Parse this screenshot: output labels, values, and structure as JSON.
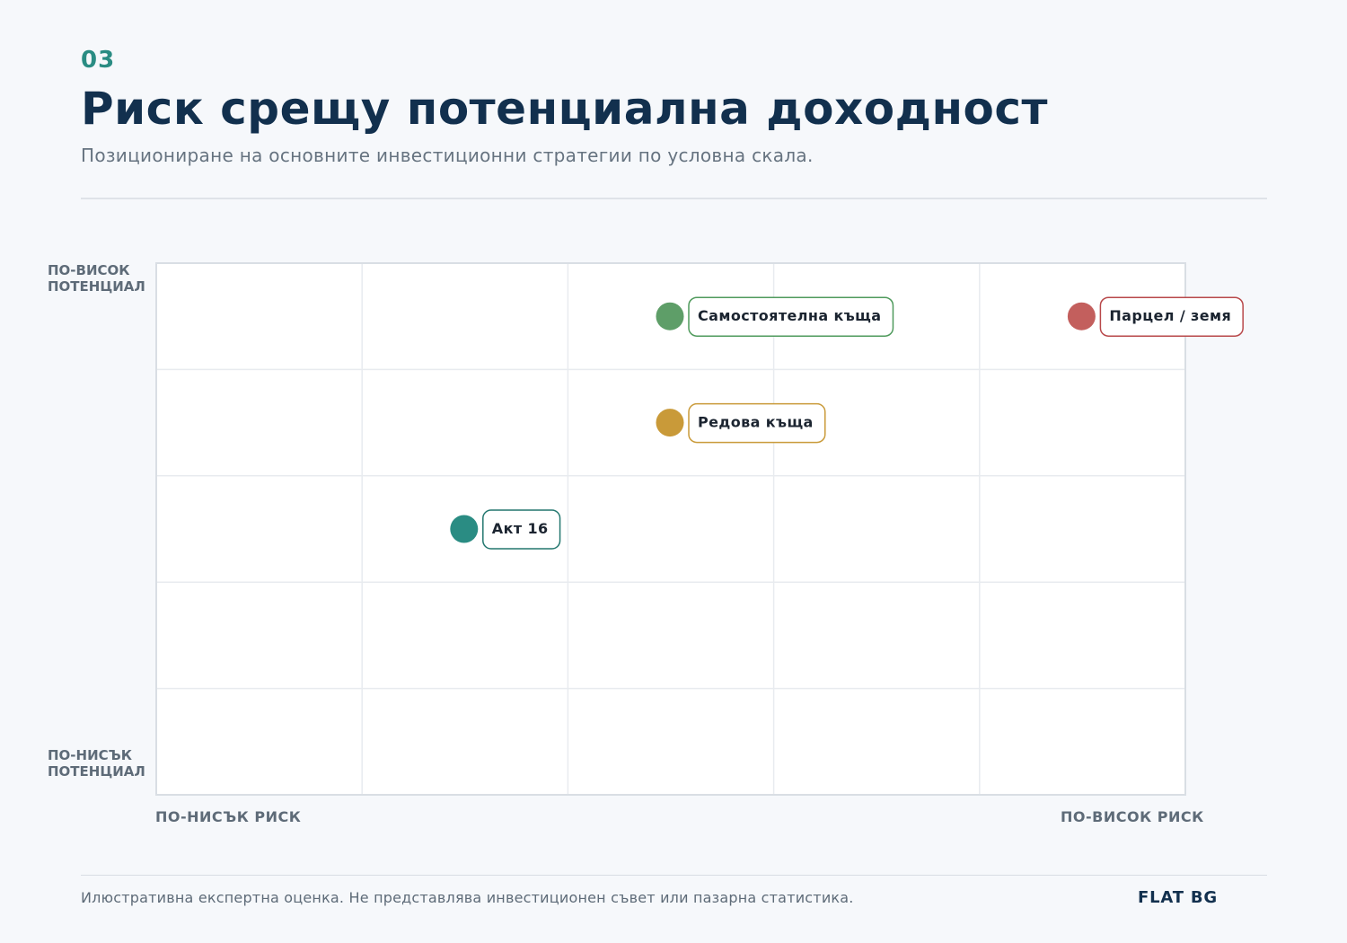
{
  "header": {
    "eyebrow": "03",
    "title": "Риск срещу потенциална доходност",
    "subtitle": "Позициониране на основните инвестиционни стратегии по условна скала."
  },
  "axes": {
    "y_high": [
      "ПО-ВИСОК",
      "ПОТЕНЦИАЛ"
    ],
    "y_low": [
      "ПО-НИСЪК",
      "ПОТЕНЦИАЛ"
    ],
    "x_low": "ПО-НИСЪК РИСК",
    "x_high": "ПО-ВИСОК РИСК"
  },
  "footer": {
    "note": "Илюстративна експертна оценка. Не представлява инвестиционен съвет или пазарна статистика.",
    "brand": "FLAT BG"
  },
  "chart_data": {
    "type": "scatter",
    "title": "Риск срещу потенциална доходност",
    "xlabel": "",
    "ylabel": "",
    "xlim": [
      0,
      5
    ],
    "ylim": [
      0,
      5
    ],
    "grid": true,
    "points": [
      {
        "label": "Самостоятелна къща",
        "x": 2.5,
        "y": 4.5,
        "color": "#5e9e68",
        "border": "#4f9a5c"
      },
      {
        "label": "Парцел / земя",
        "x": 4.5,
        "y": 4.5,
        "color": "#c35f5d",
        "border": "#b8484a"
      },
      {
        "label": "Редова къща",
        "x": 2.5,
        "y": 3.5,
        "color": "#c99a39",
        "border": "#c99a39"
      },
      {
        "label": "Акт 16",
        "x": 1.5,
        "y": 2.5,
        "color": "#2a8c83",
        "border": "#23776f"
      }
    ]
  }
}
